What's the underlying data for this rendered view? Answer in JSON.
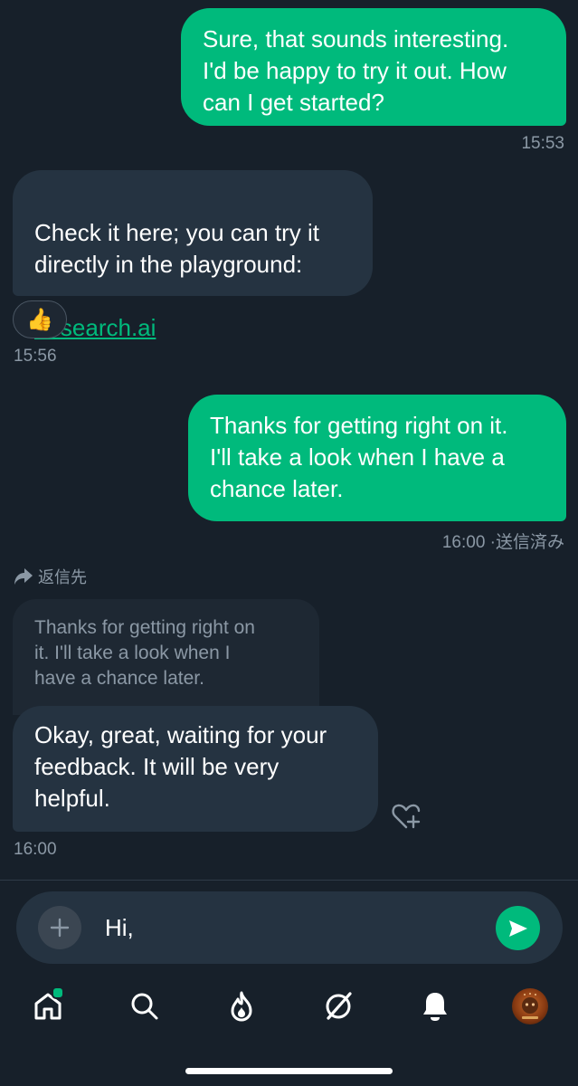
{
  "messages": [
    {
      "text": "Sure, that sounds interesting.\nI'd be happy to try it out. How\ncan I get started?",
      "time": "15:53"
    },
    {
      "text": "Check it here; you can try it\ndirectly in the playground:",
      "link": "desearch.ai",
      "reaction": "👍",
      "time": "15:56"
    },
    {
      "text": "Thanks for getting right on it.\nI'll take a look when I have a\nchance later.",
      "time": "16:00",
      "status": "·送信済み"
    },
    {
      "reply_label": "返信先",
      "quoted": "Thanks for getting right on\nit. I'll take a look when I\nhave a chance later.",
      "text": "Okay, great, waiting for your\nfeedback. It will be very\nhelpful.",
      "time": "16:00"
    }
  ],
  "composer": {
    "value": "Hi,"
  },
  "tabbar": {
    "items": [
      "home-icon",
      "search-icon",
      "flame-icon",
      "slash-circle-icon",
      "bell-icon",
      "avatar"
    ]
  },
  "colors": {
    "background": "#17202a",
    "outgoing_bubble": "#00ba7c",
    "incoming_bubble": "#253341",
    "muted_text": "#8b98a5",
    "accent": "#00ba7c"
  }
}
